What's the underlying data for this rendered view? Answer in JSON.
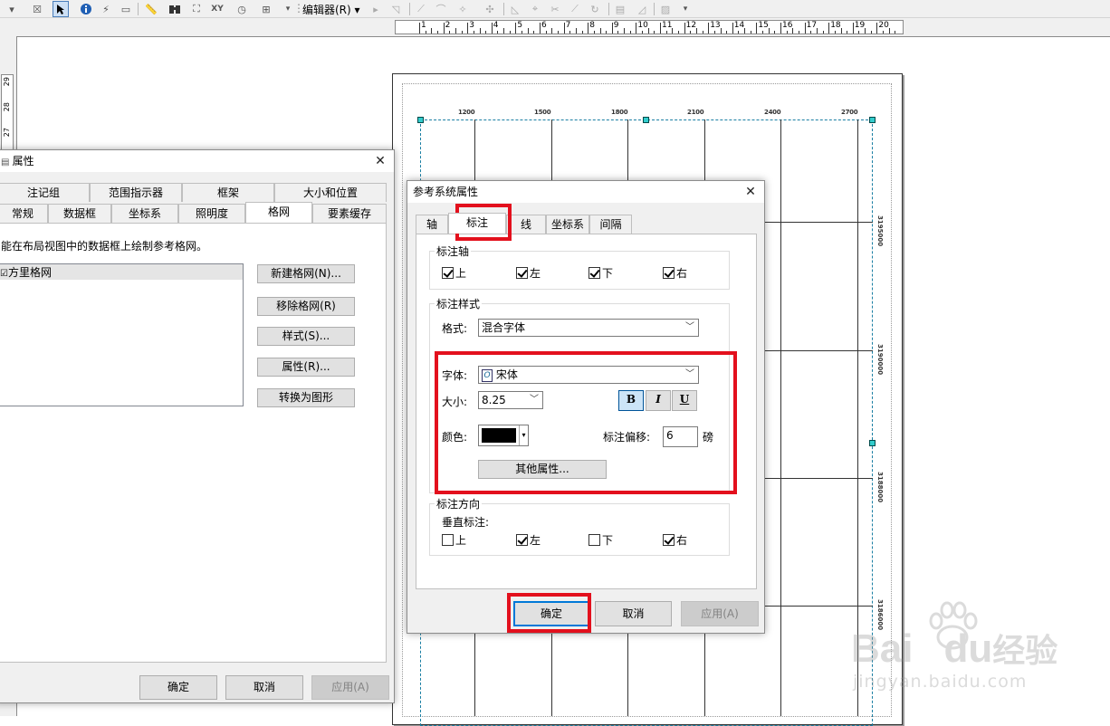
{
  "toolbar": {
    "editor_menu": "编辑器(R)",
    "xy_label": "XY"
  },
  "ruler": {
    "top_marks": [
      "1",
      "2",
      "3",
      "4",
      "5",
      "6",
      "7",
      "8",
      "9",
      "10",
      "11",
      "12",
      "13",
      "14",
      "15",
      "16",
      "17",
      "18",
      "19",
      "20"
    ],
    "left_marks": [
      "29",
      "28",
      "27"
    ]
  },
  "map": {
    "top_labels": [
      "1200",
      "1500",
      "1800",
      "2100",
      "2400",
      "2700"
    ],
    "right_labels": [
      "3195000",
      "3190000",
      "3188000",
      "3186000"
    ],
    "frame_color": "#1a7fa3"
  },
  "props_dialog": {
    "title": "属性",
    "tabs_row1": [
      "注记组",
      "范围指示器",
      "框架",
      "大小和位置"
    ],
    "tabs_row2": [
      "常规",
      "数据框",
      "坐标系",
      "照明度",
      "格网",
      "要素缓存"
    ],
    "selected_tab": "格网",
    "description": "能在布局视图中的数据框上绘制参考格网。",
    "grid_list": [
      "方里格网"
    ],
    "buttons": {
      "new_grid": "新建格网(N)...",
      "remove_grid": "移除格网(R)",
      "style": "样式(S)...",
      "properties": "属性(R)...",
      "convert": "转换为图形"
    },
    "ok": "确定",
    "cancel": "取消",
    "apply": "应用(A)"
  },
  "ref_dialog": {
    "title": "参考系统属性",
    "tabs": [
      "轴",
      "标注",
      "线",
      "坐标系",
      "间隔"
    ],
    "selected_tab": "标注",
    "label_axes": {
      "group": "标注轴",
      "items": [
        {
          "label": "上",
          "checked": true
        },
        {
          "label": "左",
          "checked": true
        },
        {
          "label": "下",
          "checked": true
        },
        {
          "label": "右",
          "checked": true
        }
      ]
    },
    "label_style": {
      "group": "标注样式",
      "format_label": "格式:",
      "format_value": "混合字体",
      "font_label": "字体:",
      "font_value": "宋体",
      "size_label": "大小:",
      "size_value": "8.25",
      "bold": "B",
      "italic": "I",
      "underline": "U",
      "color_label": "颜色:",
      "color_value": "#000000",
      "offset_label": "标注偏移:",
      "offset_value": "6",
      "offset_unit": "磅",
      "other_props": "其他属性..."
    },
    "label_direction": {
      "group": "标注方向",
      "vertical_label": "垂直标注:",
      "items": [
        {
          "label": "上",
          "checked": false
        },
        {
          "label": "左",
          "checked": true
        },
        {
          "label": "下",
          "checked": false
        },
        {
          "label": "右",
          "checked": true
        }
      ]
    },
    "ok": "确定",
    "cancel": "取消",
    "apply": "应用(A)"
  },
  "annotation_color": "#e3101d",
  "watermark": {
    "brand_left": "Bai",
    "brand_right": "du",
    "brand_cn": "经验",
    "url": "jingyan.baidu.com"
  }
}
